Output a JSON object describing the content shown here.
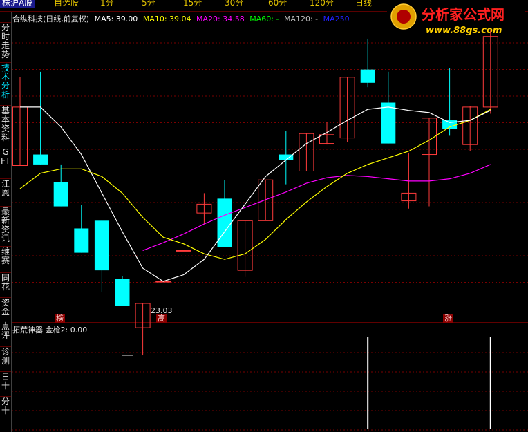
{
  "topbar": {
    "items": [
      {
        "label": "株沪A股",
        "active": true
      },
      {
        "label": "自选股"
      },
      {
        "label": "1分"
      },
      {
        "label": "5分"
      },
      {
        "label": "15分"
      },
      {
        "label": "30分"
      },
      {
        "label": "60分"
      },
      {
        "label": "120分"
      },
      {
        "label": "日线"
      }
    ]
  },
  "logo": {
    "title": "分析家公式网",
    "url": "www.88gs.com"
  },
  "sidebar": {
    "items": [
      {
        "label": "分时走势"
      },
      {
        "label": "技术分析",
        "selected": true
      },
      {
        "label": "基本资料"
      },
      {
        "label": "GFT"
      },
      {
        "label": "江恩"
      },
      {
        "label": "最新资讯"
      },
      {
        "label": "维赛"
      },
      {
        "label": "同花"
      },
      {
        "label": "资金"
      },
      {
        "label": "点评"
      },
      {
        "label": "诊测"
      },
      {
        "label": "日十"
      },
      {
        "label": "分十"
      }
    ]
  },
  "legend": {
    "title": "合纵科技(日线,前复权)",
    "ma5": "MA5: 39.00",
    "ma10": "MA10: 39.04",
    "ma20": "MA20: 34.58",
    "ma60": "MA60: -",
    "ma120": "MA120: -",
    "ma250": "MA250"
  },
  "colors": {
    "up": "#ff3b3b",
    "down": "#00ffff",
    "ma5": "#ffffff",
    "ma10": "#ffff00",
    "ma20": "#ff00ff",
    "ma60": "#00ff00",
    "ma250": "#2020ff",
    "grid": "#7a0000"
  },
  "markers": {
    "left": "榜",
    "mid": "高",
    "right": "涨"
  },
  "min_label": "23.03",
  "indicator": {
    "label": "拓荒神器 金枪2: 0.00"
  },
  "chart_data": {
    "type": "candlestick",
    "price_range": [
      21.5,
      47.5
    ],
    "candles": [
      {
        "o": 34.5,
        "c": 39.8,
        "h": 42.5,
        "l": 34.5
      },
      {
        "o": 35.5,
        "c": 34.6,
        "h": 43.0,
        "l": 34.6
      },
      {
        "o": 33.0,
        "c": 30.8,
        "h": 34.6,
        "l": 30.8
      },
      {
        "o": 28.8,
        "c": 26.6,
        "h": 30.9,
        "l": 26.6
      },
      {
        "o": 29.5,
        "c": 25.0,
        "h": 29.5,
        "l": 23.0
      },
      {
        "o": 24.2,
        "c": 21.8,
        "h": 24.5,
        "l": 21.8
      },
      {
        "o": 19.8,
        "c": 22.0,
        "h": 22.0,
        "l": 17.3
      },
      {
        "o": 24.0,
        "c": 24.0,
        "h": 24.0,
        "l": 24.0
      },
      {
        "o": 26.8,
        "c": 26.8,
        "h": 26.8,
        "l": 26.8
      },
      {
        "o": 30.2,
        "c": 31.0,
        "h": 32.0,
        "l": 29.2
      },
      {
        "o": 31.5,
        "c": 27.1,
        "h": 33.2,
        "l": 27.1
      },
      {
        "o": 25.0,
        "c": 29.5,
        "h": 29.5,
        "l": 24.4
      },
      {
        "o": 29.5,
        "c": 33.2,
        "h": 33.2,
        "l": 29.5
      },
      {
        "o": 35.5,
        "c": 35.0,
        "h": 37.6,
        "l": 32.8
      },
      {
        "o": 34.0,
        "c": 37.4,
        "h": 37.4,
        "l": 34.0
      },
      {
        "o": 36.5,
        "c": 37.3,
        "h": 38.4,
        "l": 36.4
      },
      {
        "o": 37.0,
        "c": 42.5,
        "h": 42.5,
        "l": 36.6
      },
      {
        "o": 43.2,
        "c": 42.0,
        "h": 46.0,
        "l": 41.6
      },
      {
        "o": 40.2,
        "c": 36.5,
        "h": 43.0,
        "l": 36.5
      },
      {
        "o": 31.3,
        "c": 32.0,
        "h": 35.6,
        "l": 30.6
      },
      {
        "o": 35.5,
        "c": 38.8,
        "h": 38.8,
        "l": 30.8
      },
      {
        "o": 38.6,
        "c": 37.8,
        "h": 43.3,
        "l": 37.2
      },
      {
        "o": 36.4,
        "c": 39.8,
        "h": 39.9,
        "l": 35.8
      },
      {
        "o": 39.8,
        "c": 46.2,
        "h": 46.8,
        "l": 39.2
      }
    ],
    "ma5": [
      39.8,
      39.8,
      38.0,
      35.5,
      32.0,
      28.5,
      25.2,
      24.0,
      24.6,
      26.0,
      28.5,
      31.0,
      33.5,
      35.0,
      36.5,
      37.5,
      38.6,
      39.6,
      39.8,
      39.5,
      39.3,
      38.4,
      38.6,
      39.5
    ],
    "ma10": [
      32.4,
      33.8,
      34.2,
      34.2,
      33.5,
      32.0,
      29.8,
      28.0,
      27.4,
      26.5,
      26.0,
      26.5,
      27.8,
      29.6,
      31.2,
      32.6,
      33.8,
      34.6,
      35.2,
      35.8,
      36.8,
      38.0,
      38.6,
      39.6
    ],
    "ma20": [
      null,
      null,
      null,
      null,
      null,
      null,
      26.8,
      27.5,
      28.3,
      29.2,
      30.0,
      30.7,
      31.4,
      32.1,
      32.9,
      33.4,
      33.6,
      33.5,
      33.3,
      33.1,
      33.1,
      33.3,
      33.8,
      34.6
    ],
    "indicator_bars": [
      {
        "index": 17,
        "value": 1
      },
      {
        "index": 23,
        "value": 1
      }
    ]
  }
}
